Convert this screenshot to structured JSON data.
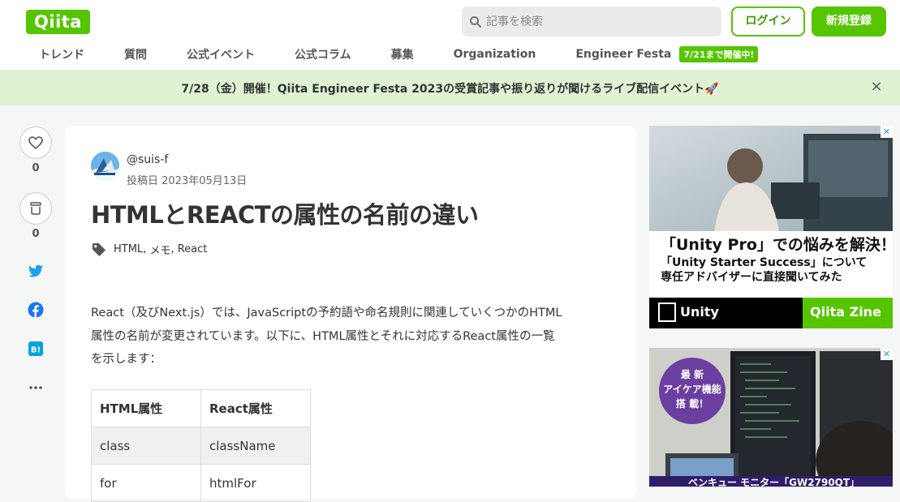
{
  "header": {
    "logo": "Qiita",
    "search_placeholder": "記事を検索",
    "login_label": "ログイン",
    "signup_label": "新規登録",
    "nav": [
      "トレンド",
      "質問",
      "公式イベント",
      "公式コラム",
      "募集",
      "Organization",
      "Engineer Festa"
    ],
    "festa_badge": "7/21まで開催中!"
  },
  "banner": {
    "text": "7/28（金）開催！Qiita Engineer Festa 2023の受賞記事や振り返りが聞けるライブ配信イベント🚀",
    "close_label": "×"
  },
  "sidebar": {
    "like_count": "0",
    "stock_count": "0"
  },
  "article": {
    "username": "@suis-f",
    "posted": "投稿日 2023年05月13日",
    "title": "HTMLとREACTの属性の名前の違い",
    "tags": [
      "HTML",
      "メモ",
      "React"
    ],
    "body_lines": [
      "React（及びNext.js）では、JavaScriptの予約語や命名規則に関連していくつかのHTML",
      "属性の名前が変更されています。以下に、HTML属性とそれに対応するReact属性の一覧",
      "を示します："
    ],
    "table": {
      "headers": [
        "HTML属性",
        "React属性"
      ],
      "rows": [
        [
          "class",
          "className"
        ],
        [
          "for",
          "htmlFor"
        ]
      ]
    }
  },
  "ads": {
    "ad1": {
      "line1": "「Unity Pro」での悩みを解決！",
      "line2": "「Unity Starter Success」について",
      "line3": "専任アドバイザーに直接聞いてみた",
      "brand_left": "Unity",
      "brand_right": "Qiita Zine"
    },
    "ad2": {
      "badge": "最 新\nアイケア機能\n搭 載！",
      "caption": "ベンキュー モニター「GW2790QT」"
    }
  },
  "colors": {
    "brand": "#55c500",
    "banner_bg": "#dff3d3",
    "page_bg": "#f5f6f6"
  }
}
